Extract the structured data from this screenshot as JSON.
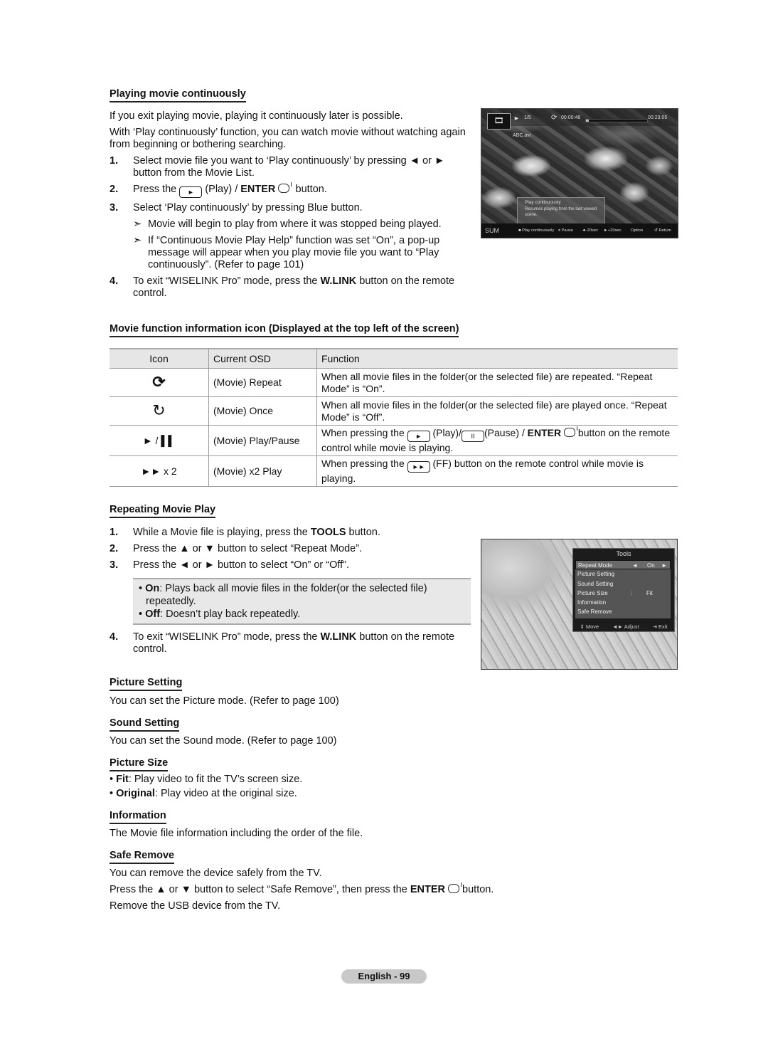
{
  "section1": {
    "heading": "Playing movie continuously",
    "intro1": "If you exit playing movie, playing it continuously later is possible.",
    "intro2": "With ‘Play continuously’ function, you can watch movie without watching again from beginning or bothering searching.",
    "steps": [
      {
        "num": "1.",
        "text_a": "Select movie file you want to ‘Play continuously’ by pressing ◄ or ►",
        "text_b": "button from the Movie List."
      },
      {
        "num": "2.",
        "pre": "Press the",
        "mid": "(Play) / ",
        "bold": "ENTER",
        "post": "button."
      },
      {
        "num": "3.",
        "text": "Select ‘Play continuously’ by pressing Blue button."
      },
      {
        "num": "4.",
        "pre": "To exit “WISELINK Pro” mode, press the ",
        "bold": "W.LINK",
        "post": " button on the remote control."
      }
    ],
    "notes": [
      "Movie will begin to play from where it was stopped being played.",
      "If “Continuous Movie Play Help” function was set “On”, a pop-up message will appear when you play movie file you want to “Play continuously”. (Refer to page 101)"
    ],
    "note_arrow": "➣"
  },
  "player": {
    "play_icon": "►",
    "track": "1/5",
    "repeat_icon": "⟳",
    "elapsed": "00:00:48",
    "total": "00:23:05",
    "progress_fraction": 0.05,
    "filename": "ABC.avi",
    "popup_title": "Play continuously",
    "popup_text": "Resumes playing from the last viewed scene.",
    "device": "SUM",
    "bottom_controls": [
      "■ Play continuously",
      "⏸ Pause",
      "◄-20sec",
      "►+20sec",
      "Option",
      "↺ Return"
    ]
  },
  "section2": {
    "heading": "Movie function information icon (Displayed at the top left of the screen)",
    "table": {
      "headers": [
        "Icon",
        "Current OSD",
        "Function"
      ],
      "rows": [
        {
          "icon": "⟲⟳",
          "osd": "(Movie) Repeat",
          "function": "When all movie files in the folder(or the selected file) are repeated. “Repeat Mode” is “On”."
        },
        {
          "icon": "⟳",
          "osd": "(Movie) Once",
          "function": "When all movie files in the folder(or the selected file) are played once. “Repeat Mode” is “Off”."
        },
        {
          "icon": "► / ▌▌",
          "osd": "(Movie) Play/Pause",
          "function_pre": "When pressing the",
          "function_mid1": "(Play)/",
          "function_mid2": "(Pause) / ",
          "function_bold": "ENTER",
          "function_post": "button on the remote control while movie is playing."
        },
        {
          "icon": "►► x 2",
          "osd": "(Movie) x2 Play",
          "function_pre": "When pressing the",
          "function_post": "(FF) button on the remote control while movie is playing."
        }
      ]
    }
  },
  "section3": {
    "heading": "Repeating Movie Play",
    "steps": [
      {
        "num": "1.",
        "pre": "While a Movie file is playing, press the ",
        "bold": "TOOLS",
        "post": " button."
      },
      {
        "num": "2.",
        "text": "Press the ▲ or ▼ button to select “Repeat Mode”."
      },
      {
        "num": "3.",
        "text": "Press the ◄ or ► button to select “On” or “Off”."
      },
      {
        "num": "4.",
        "pre": "To exit “WISELINK Pro” mode, press the ",
        "bold": "W.LINK",
        "post": " button on the remote control."
      }
    ],
    "options": [
      {
        "bold": "On",
        "text": ": Plays back all movie files in the folder(or the selected file) repeatedly."
      },
      {
        "bold": "Off",
        "text": ": Doesn’t play back repeatedly."
      }
    ]
  },
  "tools_menu": {
    "title": "Tools",
    "items": [
      {
        "label": "Repeat Mode",
        "value": "On",
        "selected": true
      },
      {
        "label": "Picture Setting"
      },
      {
        "label": "Sound Setting"
      },
      {
        "label": "Picture Size",
        "value": "Fit"
      },
      {
        "label": "Information"
      },
      {
        "label": "Safe Remove"
      }
    ],
    "footer": [
      "⇕ Move",
      "◄► Adjust",
      "⇥ Exit"
    ]
  },
  "section4": {
    "picture_setting": {
      "heading": "Picture Setting",
      "text": "You can set the Picture mode. (Refer to page 100)"
    },
    "sound_setting": {
      "heading": "Sound Setting",
      "text": "You can set the Sound mode. (Refer to page 100)"
    },
    "picture_size": {
      "heading": "Picture Size",
      "items": [
        {
          "bold": "Fit",
          "text": ": Play video to fit the TV’s screen size."
        },
        {
          "bold": "Original",
          "text": ": Play video at the original size."
        }
      ]
    },
    "information": {
      "heading": "Information",
      "text": "The Movie file information including the order of the file."
    },
    "safe_remove": {
      "heading": "Safe Remove",
      "line1": "You can remove the device safely from the TV.",
      "line2_pre": "Press the ▲ or ▼ button to select “Safe Remove”, then press the ",
      "line2_bold": "ENTER",
      "line2_post": " button.",
      "line3": "Remove the USB device from the TV."
    }
  },
  "footer": {
    "page_label": "English - 99"
  }
}
